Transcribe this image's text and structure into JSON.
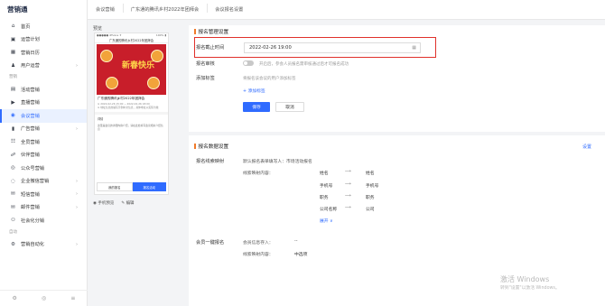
{
  "app": {
    "brand": "营销通"
  },
  "breadcrumb": [
    "会议营销",
    "广东通的腾讯乡村2022年团拜会",
    "会议报名设置"
  ],
  "sidebar": {
    "items": [
      {
        "label": "首页",
        "icon": "home-icon",
        "glyph": "⌂"
      },
      {
        "label": "运营计划",
        "icon": "plan-icon",
        "glyph": "▣"
      },
      {
        "label": "营销日历",
        "icon": "calendar-icon",
        "glyph": "▦"
      },
      {
        "label": "用户运营",
        "icon": "user-icon",
        "glyph": "♟",
        "arrow": "›"
      }
    ],
    "group1": "营销",
    "items2": [
      {
        "label": "活动营销",
        "icon": "activity-icon",
        "glyph": "▤"
      },
      {
        "label": "直播营销",
        "icon": "live-icon",
        "glyph": "▶"
      },
      {
        "label": "会议营销",
        "icon": "meeting-icon",
        "glyph": "◉",
        "active": true
      },
      {
        "label": "广告营销",
        "icon": "ad-icon",
        "glyph": "▮",
        "arrow": "›"
      },
      {
        "label": "全员营销",
        "icon": "team-icon",
        "glyph": "☷"
      },
      {
        "label": "伙伴营销",
        "icon": "partner-icon",
        "glyph": "☍"
      },
      {
        "label": "公众号营销",
        "icon": "wechat-icon",
        "glyph": "◎"
      },
      {
        "label": "企业微信营销",
        "icon": "wecom-icon",
        "glyph": "◌",
        "arrow": "›"
      },
      {
        "label": "短信营销",
        "icon": "sms-icon",
        "glyph": "✉",
        "arrow": "›"
      },
      {
        "label": "邮件营销",
        "icon": "mail-icon",
        "glyph": "✉",
        "arrow": "›"
      },
      {
        "label": "社会化分销",
        "icon": "share-icon",
        "glyph": "⚇"
      }
    ],
    "group2": "自动",
    "items3": [
      {
        "label": "营销自动化",
        "icon": "automation-icon",
        "glyph": "⚙",
        "arrow": "›"
      }
    ],
    "footer": [
      "⚙",
      "◎",
      "≡"
    ]
  },
  "preview": {
    "title": "预览",
    "phone_status_left": "●●●●● iPhone ✈",
    "phone_status_right": "100% ▮",
    "phone_nav": "广东通的腾讯乡村2022年团拜会",
    "banner_word": "新春快乐",
    "event_title": "广东通的腾讯乡村2022年团拜会",
    "meta1": "⊙ 2022-02-26 15:00 ~ 2022-02-26 18:00",
    "meta2": "⊙ 地址信息的编写示例中文信息，具体地址以实际为准",
    "section_label": "详情",
    "desc": "这里是会议的详细内容介绍，请在此处填写会议相关介绍信息",
    "btn_left": "我的报名",
    "btn_right": "报名活动",
    "link1": "手机预览",
    "link2": "编辑"
  },
  "form": {
    "section1": "报名管理设置",
    "deadline_label": "报名截止时间",
    "deadline_value": "2022-02-26 19:00",
    "review_label": "报名审核",
    "review_hint": "开启后，参会人员报名需审核通过后才可报名成功",
    "tag_label": "添加标签",
    "tag_hint": "将报名该会议的用户添加标签",
    "add_tag": "+ 添加标签",
    "save": "保存",
    "cancel": "取消"
  },
  "data_settings": {
    "section2": "报名数据设置",
    "settings_link": "设置",
    "sync_label": "报名线索映射",
    "sync_hint": "默认报名表单填写人：市场活动报名",
    "map_label": "线索映射内容：",
    "mappings": [
      {
        "from": "姓名",
        "to": "姓名"
      },
      {
        "from": "手机号",
        "to": "手机号"
      },
      {
        "from": "职务",
        "to": "职务"
      },
      {
        "from": "公司名称",
        "to": "公司"
      }
    ],
    "arrow": "⟶",
    "expand": "展开 ∨",
    "oneclick_label": "会员一键报名",
    "member_store": "会员信息存入：",
    "member_store_value": "--",
    "map_label2": "线索映射内容：",
    "map_value2": "中选项"
  },
  "watermark": {
    "line1": "激活 Windows",
    "line2": "转到\"设置\"以激活 Windows。"
  },
  "colors": {
    "primary": "#2f6bff",
    "highlight": "#e0312b",
    "accent": "#f07a2a"
  }
}
